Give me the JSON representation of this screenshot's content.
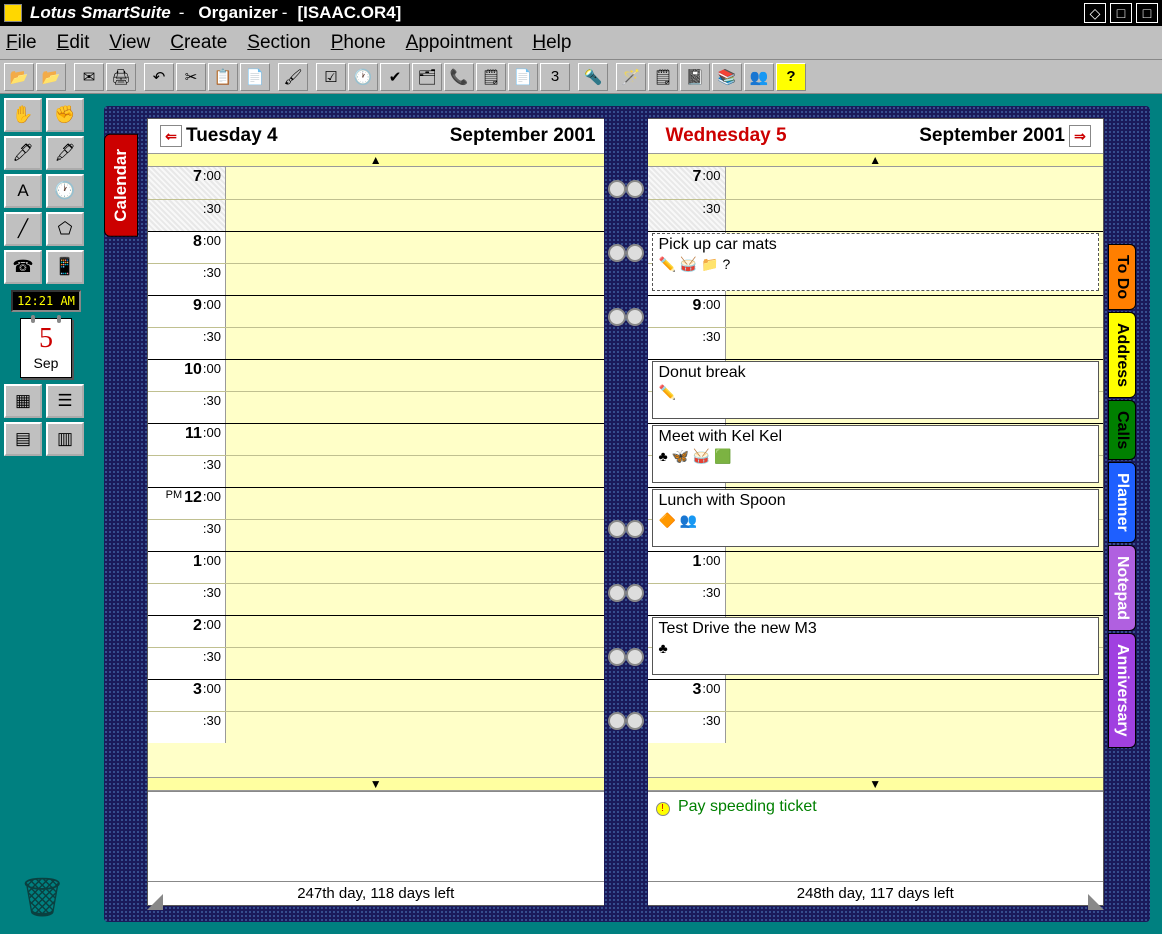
{
  "titlebar": {
    "suite": "Lotus SmartSuite",
    "app": "Organizer",
    "doc": "[ISAAC.OR4]",
    "dash": "-"
  },
  "menus": [
    "File",
    "Edit",
    "View",
    "Create",
    "Section",
    "Phone",
    "Appointment",
    "Help"
  ],
  "toolbar_icons": [
    "open-folder",
    "open-folder2",
    "mail",
    "print",
    "undo",
    "cut",
    "copy",
    "paste",
    "brush",
    "checklist",
    "clock",
    "checkmark",
    "card",
    "phone",
    "props",
    "page",
    "date3",
    "flashlight",
    "wand",
    "notepad",
    "notebook",
    "book",
    "people",
    "help"
  ],
  "palette": {
    "rows": [
      [
        "hand-open",
        "hand-grab"
      ],
      [
        "pen",
        "pen2"
      ],
      [
        "page-a",
        "clock2"
      ],
      [
        "line",
        "shape"
      ],
      [
        "phone2",
        "modem"
      ]
    ],
    "grid_rows": [
      [
        "view-icons",
        "view-list"
      ],
      [
        "view-detail",
        "view-grid"
      ]
    ]
  },
  "clock": "12:21 AM",
  "datecard": {
    "num": "5",
    "mon": "Sep"
  },
  "left_tab": "Calendar",
  "side_tabs": [
    {
      "label": "To Do",
      "bg": "#ff7f00",
      "fg": "#000"
    },
    {
      "label": "Address",
      "bg": "#ffff00",
      "fg": "#000"
    },
    {
      "label": "Calls",
      "bg": "#008000",
      "fg": "#000"
    },
    {
      "label": "Planner",
      "bg": "#1e5fff",
      "fg": "#fff"
    },
    {
      "label": "Notepad",
      "bg": "#b060e0",
      "fg": "#fff"
    },
    {
      "label": "Anniversary",
      "bg": "#a040e0",
      "fg": "#fff"
    }
  ],
  "pages": {
    "left": {
      "day": "Tuesday 4",
      "month": "September 2001",
      "footer": "247th day, 118 days left",
      "appointments": []
    },
    "right": {
      "day": "Wednesday 5",
      "month": "September 2001",
      "footer": "248th day, 117 days left",
      "note": "Pay speeding ticket",
      "appointments": [
        {
          "slot": 2,
          "span": 2,
          "text": "Pick up car mats",
          "icons": "✏️ 🥁 📁 ?",
          "dotted": true
        },
        {
          "slot": 6,
          "span": 2,
          "text": "Donut break",
          "icons": "✏️"
        },
        {
          "slot": 8,
          "span": 2,
          "text": "Meet with Kel Kel",
          "icons": "♣ 🦋 🥁 🟩"
        },
        {
          "slot": 10,
          "span": 2,
          "text": "Lunch with Spoon",
          "icons": "🔶 👥"
        },
        {
          "slot": 14,
          "span": 2,
          "text": "Test Drive the new M3",
          "icons": "♣"
        }
      ]
    }
  },
  "timeslots": [
    {
      "hr": "7",
      "mn": ":00",
      "shade": true,
      "top": true
    },
    {
      "hr": "",
      "mn": ":30",
      "shade": true
    },
    {
      "hr": "8",
      "mn": ":00",
      "top": true
    },
    {
      "hr": "",
      "mn": ":30"
    },
    {
      "hr": "9",
      "mn": ":00",
      "top": true
    },
    {
      "hr": "",
      "mn": ":30"
    },
    {
      "hr": "10",
      "mn": ":00",
      "top": true
    },
    {
      "hr": "",
      "mn": ":30"
    },
    {
      "hr": "11",
      "mn": ":00",
      "top": true
    },
    {
      "hr": "",
      "mn": ":30"
    },
    {
      "hr": "12",
      "mn": ":00",
      "top": true,
      "ampm": "PM"
    },
    {
      "hr": "",
      "mn": ":30"
    },
    {
      "hr": "1",
      "mn": ":00",
      "top": true
    },
    {
      "hr": "",
      "mn": ":30"
    },
    {
      "hr": "2",
      "mn": ":00",
      "top": true
    },
    {
      "hr": "",
      "mn": ":30"
    },
    {
      "hr": "3",
      "mn": ":00",
      "top": true
    },
    {
      "hr": "",
      "mn": ":30"
    }
  ],
  "rings": [
    60,
    124,
    188,
    400,
    464,
    528,
    592
  ]
}
